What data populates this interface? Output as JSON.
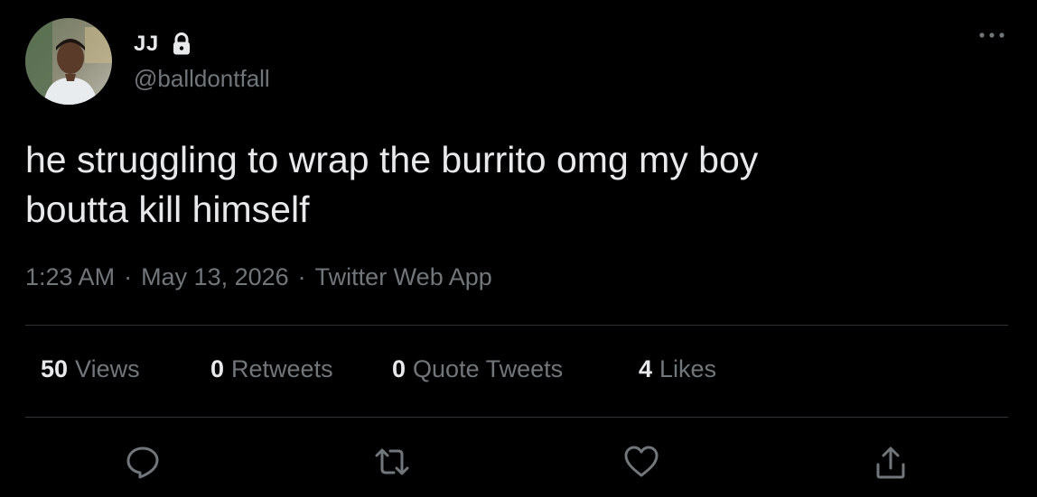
{
  "author": {
    "display_name": "JJ",
    "handle": "@balldontfall",
    "avatar_icon": "user-avatar-photo",
    "protected_icon": "lock-icon"
  },
  "tweet": {
    "text": "he struggling to wrap the burrito omg my boy\nboutta kill himself",
    "time": "1:23 AM",
    "date": "May 13, 2026",
    "source": "Twitter Web App",
    "separator": "·"
  },
  "stats": {
    "views": {
      "count": "50",
      "label": "Views"
    },
    "retweets": {
      "count": "0",
      "label": "Retweets"
    },
    "quotes": {
      "count": "0",
      "label": "Quote Tweets"
    },
    "likes": {
      "count": "4",
      "label": "Likes"
    }
  },
  "actions": {
    "reply_icon": "reply-icon",
    "retweet_icon": "retweet-icon",
    "like_icon": "heart-icon",
    "share_icon": "share-icon"
  },
  "colors": {
    "background": "#000000",
    "primary_text": "#e7e9ea",
    "secondary_text": "#71767b",
    "divider": "#2f3336"
  }
}
